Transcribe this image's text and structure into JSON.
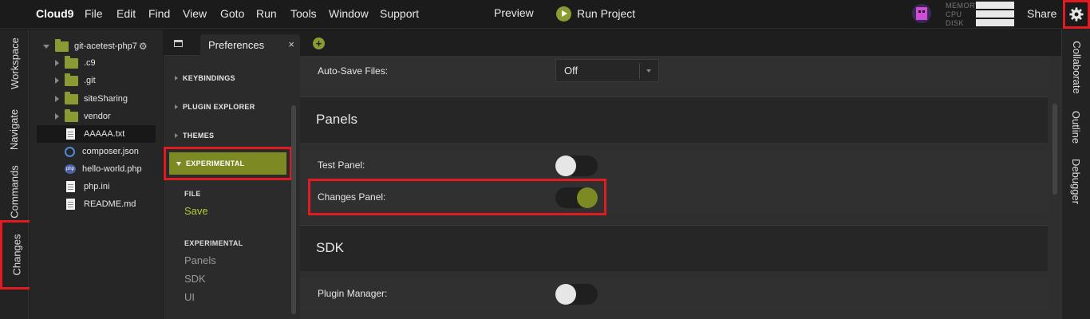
{
  "app": {
    "brand": "Cloud9"
  },
  "menu": [
    "File",
    "Edit",
    "Find",
    "View",
    "Goto",
    "Run",
    "Tools",
    "Window",
    "Support"
  ],
  "toolbar": {
    "preview": "Preview",
    "run": "Run Project",
    "share": "Share"
  },
  "meters": {
    "memory": "MEMORY",
    "cpu": "CPU",
    "disk": "DISK"
  },
  "left_tabs": [
    "Workspace",
    "Navigate",
    "Commands",
    "Changes"
  ],
  "right_tabs": [
    "Collaborate",
    "Outline",
    "Debugger"
  ],
  "tree": {
    "root": "git-acetest-php7",
    "items": [
      {
        "name": ".c9",
        "type": "folder"
      },
      {
        "name": ".git",
        "type": "folder"
      },
      {
        "name": "siteSharing",
        "type": "folder"
      },
      {
        "name": "vendor",
        "type": "folder"
      },
      {
        "name": "AAAAA.txt",
        "type": "file"
      },
      {
        "name": "composer.json",
        "type": "json"
      },
      {
        "name": "hello-world.php",
        "type": "php"
      },
      {
        "name": "php.ini",
        "type": "file"
      },
      {
        "name": "README.md",
        "type": "file"
      }
    ]
  },
  "prefs_tab": {
    "title": "Preferences",
    "close": "×"
  },
  "prefs_nav": {
    "sections": [
      "KEYBINDINGS",
      "PLUGIN EXPLORER",
      "THEMES"
    ],
    "active_section": "EXPERIMENTAL",
    "file_group": "FILE",
    "file_links": [
      "Save"
    ],
    "exp_group": "EXPERIMENTAL",
    "exp_links": [
      "Panels",
      "SDK",
      "UI"
    ]
  },
  "prefs": {
    "autosave_label": "Auto-Save Files:",
    "autosave_value": "Off",
    "panels_heading": "Panels",
    "test_panel_label": "Test Panel:",
    "test_panel_on": false,
    "changes_panel_label": "Changes Panel:",
    "changes_panel_on": true,
    "sdk_heading": "SDK",
    "plugin_manager_label": "Plugin Manager:",
    "plugin_manager_on": false
  },
  "colors": {
    "accent": "#8c9a33",
    "highlight": "#e01b22"
  }
}
